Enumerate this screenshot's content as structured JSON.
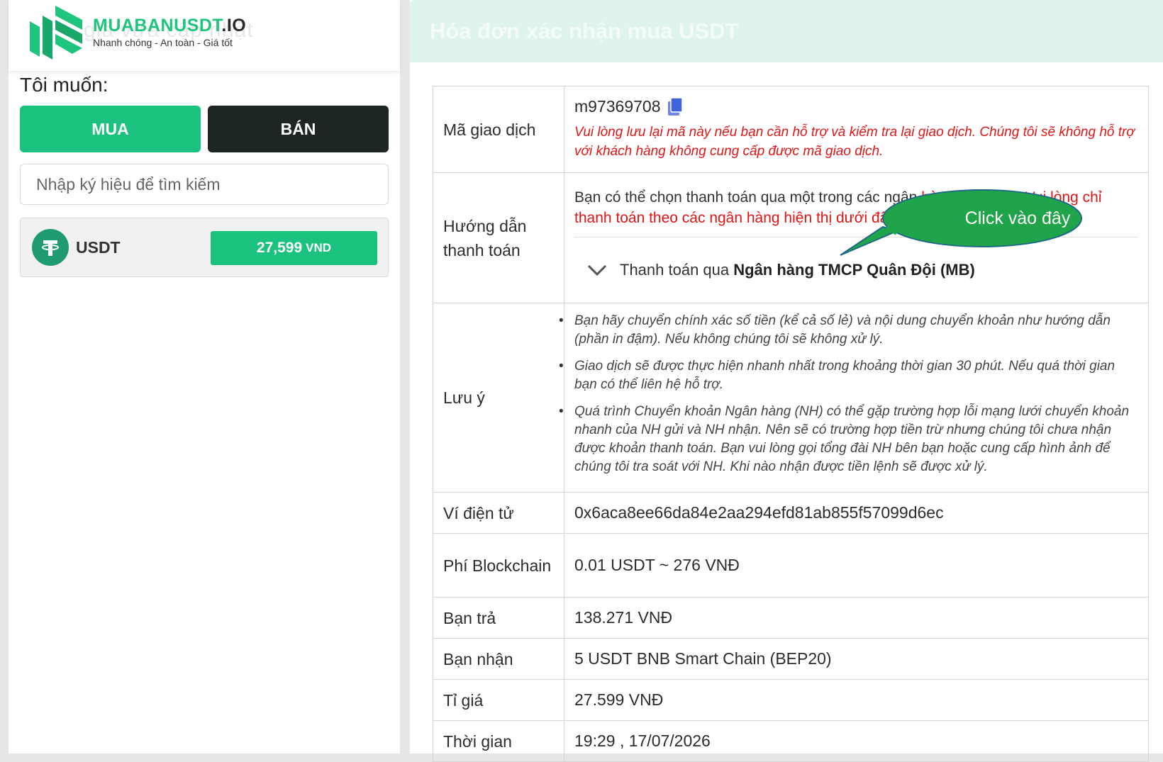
{
  "brand": {
    "name_main": "MUABANUSDT",
    "name_suffix": ".IO",
    "tagline": "Nhanh chóng - An toàn - Giá tốt",
    "ghost": "giá vừa cập nhật"
  },
  "left": {
    "want_label": "Tôi muốn:",
    "buy_label": "MUA",
    "sell_label": "BÁN",
    "search_placeholder": "Nhập ký hiệu để tìm kiếm",
    "coin": {
      "name": "USDT",
      "price": "27,599",
      "unit": "VND"
    }
  },
  "invoice": {
    "title": "Hóa đơn xác nhận mua USDT",
    "rows": {
      "tx_label": "Mã giao dịch",
      "tx_code": "m97369708",
      "tx_note": "Vui lòng lưu lại mã này nếu bạn cần hỗ trợ và kiểm tra lại giao dịch. Chúng tôi sẽ không hỗ trợ với khách hàng không cung cấp được mã giao dịch.",
      "guide_label": "Hướng dẫn thanh toán",
      "guide_first": "Bạn có thể chọn thanh toán qua một trong các ngân",
      "guide_red_mid": " hàng dưới đây. Vui lòng chỉ",
      "guide_red_2": "thanh toán theo các ngân hàng hiện thị dưới đây.",
      "bank_prefix": "Thanh toán qua ",
      "bank_name": "Ngân hàng TMCP Quân Đội (MB)",
      "note_label": "Lưu ý",
      "notes": [
        "Bạn hãy chuyển chính xác số tiền (kể cả số lẻ) và nội dung chuyển khoản như hướng dẫn (phần in đậm). Nếu không chúng tôi sẽ không xử lý.",
        "Giao dịch sẽ được thực hiện nhanh nhất trong khoảng thời gian 30 phút. Nếu quá thời gian bạn có thể liên hệ hỗ trợ.",
        "Quá trình Chuyển khoản Ngân hàng (NH) có thể gặp trường hợp lỗi mạng lưới chuyển khoản nhanh của NH gửi và NH nhận. Nên sẽ có trường hợp tiền trừ nhưng chúng tôi chưa nhận được khoản thanh toán. Bạn vui lòng gọi tổng đài NH bên bạn hoặc cung cấp hình ảnh để chúng tôi tra soát với NH. Khi nào nhận được tiền lệnh sẽ được xử lý."
      ],
      "wallet_label": "Ví điện tử",
      "wallet_value": "0x6aca8ee66da84e2aa294efd81ab855f57099d6ec",
      "fee_label": "Phí Blockchain",
      "fee_value": "0.01 USDT ~ 276 VNĐ",
      "pay_label": "Bạn trả",
      "pay_value": "138.271 VNĐ",
      "receive_label": "Bạn nhận",
      "receive_value": "5 USDT BNB Smart Chain (BEP20)",
      "rate_label": "Tỉ giá",
      "rate_value": "27.599 VNĐ",
      "time_label": "Thời gian",
      "time_value": "19:29 , 17/07/2026"
    }
  },
  "callout": {
    "text": "Click vào đây",
    "color": "#1fa44a"
  },
  "colors": {
    "accent": "#1bc27e",
    "dark": "#1d2622",
    "warning": "#e11515"
  }
}
